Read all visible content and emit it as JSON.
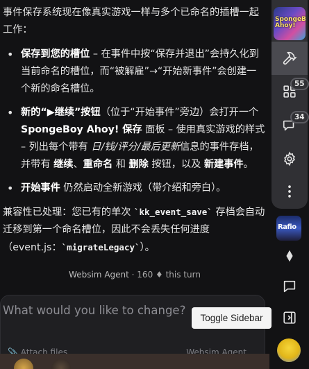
{
  "message": {
    "intro": "事件保存系统现在像真实游戏一样与多个已命名的插槽一起工作：",
    "bullets": [
      {
        "bold": "保存到您的槽位",
        "text": " – 在事件中按“保存并退出”会持久化到当前命名的槽位，而“被解雇”→“开始新事件”会创建一个新的命名槽位。"
      },
      {
        "bold": "新的“▶继续”按钮",
        "text_a": "（位于“开始事件”旁边）会打开一个 ",
        "bold_b": "SpongeBoy Ahoy! 保存",
        "text_c": " 面板 – 使用真实游戏的样式 – 列出每个带有 ",
        "italic_d": "日/钱/评分/最后更新",
        "text_e": "信息的事件存档，并带有 ",
        "bold_f": "继续",
        "sep1": "、",
        "bold_g": "重命名",
        "text_h": " 和 ",
        "bold_i": "删除",
        "text_j": " 按钮，以及 ",
        "bold_k": "新建事件",
        "text_l": "。"
      },
      {
        "bold": "开始事件",
        "text": " 仍然启动全新游戏（带介绍和旁白）。"
      }
    ],
    "compat_a": "兼容性已处理：您已有的单次 ",
    "compat_code1": "`kk_event_save`",
    "compat_b": " 存档会自动迁移到第一个命名槽位，因此不会丢失任何进度（event.js：",
    "compat_code2": "`migrateLegacy`",
    "compat_c": "）。"
  },
  "meta": {
    "agent": "Websim Agent",
    "separator": " · ",
    "cost": "160 ♦ this turn"
  },
  "composer": {
    "placeholder": "What would you like to change?",
    "attach_label": "Attach files",
    "agent_label": "Websim Agent"
  },
  "tooltip": {
    "text": "Toggle Sidebar"
  },
  "rail": {
    "top_thumb_text": "SpongeBoy Ahoy!",
    "apps_badge": "55",
    "comments_badge": "34",
    "mid_thumb_text": "Rafio"
  }
}
